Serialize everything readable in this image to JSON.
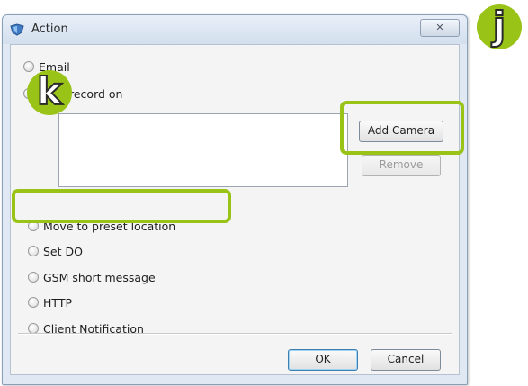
{
  "window": {
    "title": "Action",
    "close_label": "✕"
  },
  "options": {
    "email": "Email",
    "record": "record on",
    "move_preset": "Move to preset location",
    "set_do": "Set DO",
    "gsm": "GSM short message",
    "http": "HTTP",
    "client_notification": "Client Notification"
  },
  "buttons": {
    "add_camera": "Add Camera",
    "remove": "Remove",
    "ok": "OK",
    "cancel": "Cancel"
  },
  "badges": {
    "j": "j",
    "k": "k"
  },
  "colors": {
    "highlight": "#9ac317",
    "dialog_bg": "#dfe8f3"
  },
  "icons": [
    "app-shield-icon",
    "close-icon"
  ]
}
